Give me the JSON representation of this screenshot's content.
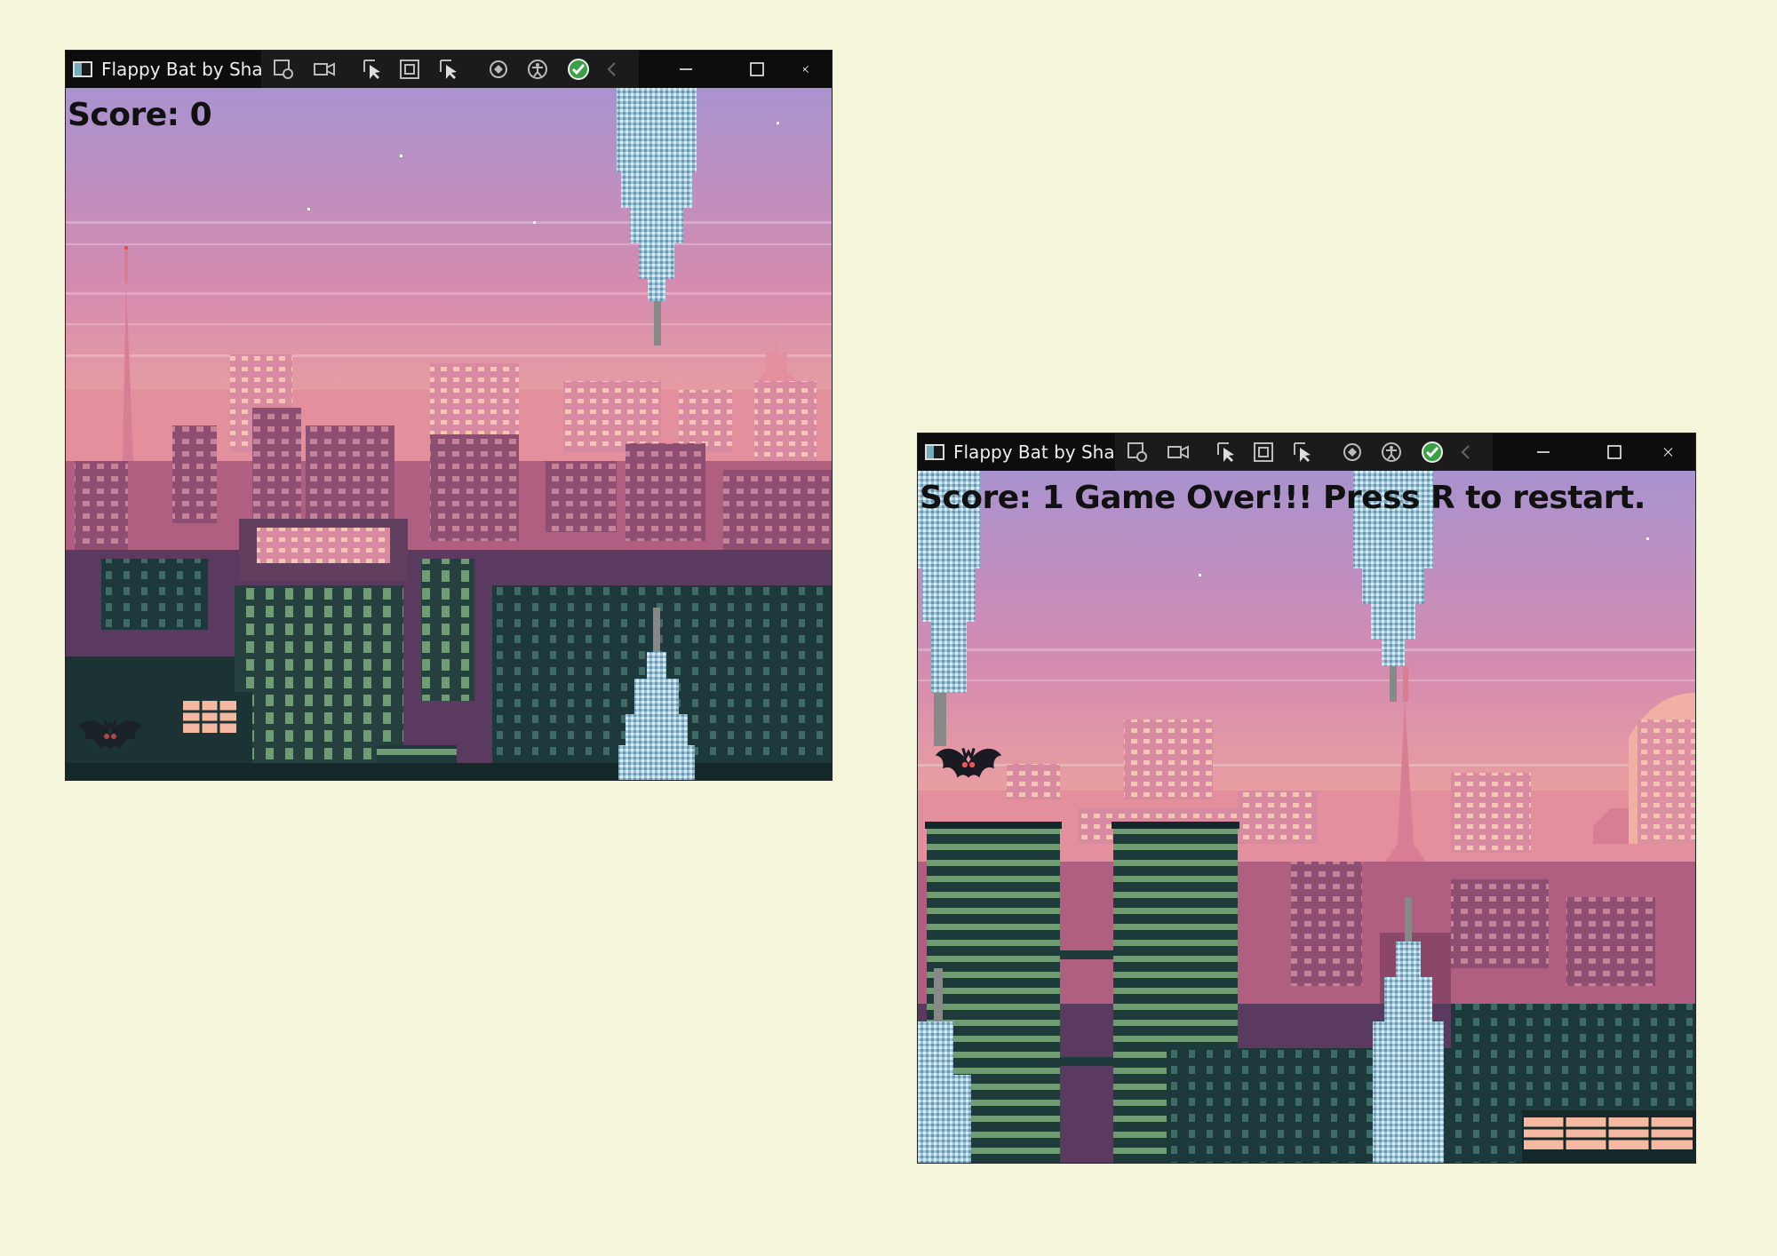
{
  "windows": [
    {
      "title": "Flappy Bat by Shane",
      "score_text": "Score: 0",
      "icons": [
        "app-icon",
        "inspect-icon",
        "video-icon",
        "select-arrow-icon",
        "frame-icon",
        "select-element-icon",
        "hot-reload-icon",
        "accessibility-icon",
        "check-icon",
        "collapse-chevron-icon",
        "minimize-icon",
        "maximize-icon",
        "close-icon"
      ]
    },
    {
      "title": "Flappy Bat by Shane",
      "score_text": "Score: 1 Game Over!!! Press R to restart.",
      "icons": [
        "app-icon",
        "inspect-icon",
        "video-icon",
        "select-arrow-icon",
        "frame-icon",
        "select-element-icon",
        "hot-reload-icon",
        "accessibility-icon",
        "check-icon",
        "collapse-chevron-icon",
        "minimize-icon",
        "maximize-icon",
        "close-icon"
      ]
    }
  ],
  "colors": {
    "page_background": "#f5f5dc",
    "sky_top": "#a993cf",
    "sky_mid": "#d78aa6",
    "sky_low": "#f0a79b",
    "building_far": "#c96d8a",
    "building_mid": "#7a4a6a",
    "building_near": "#1f3b3e",
    "tower": "#a9cde0"
  }
}
